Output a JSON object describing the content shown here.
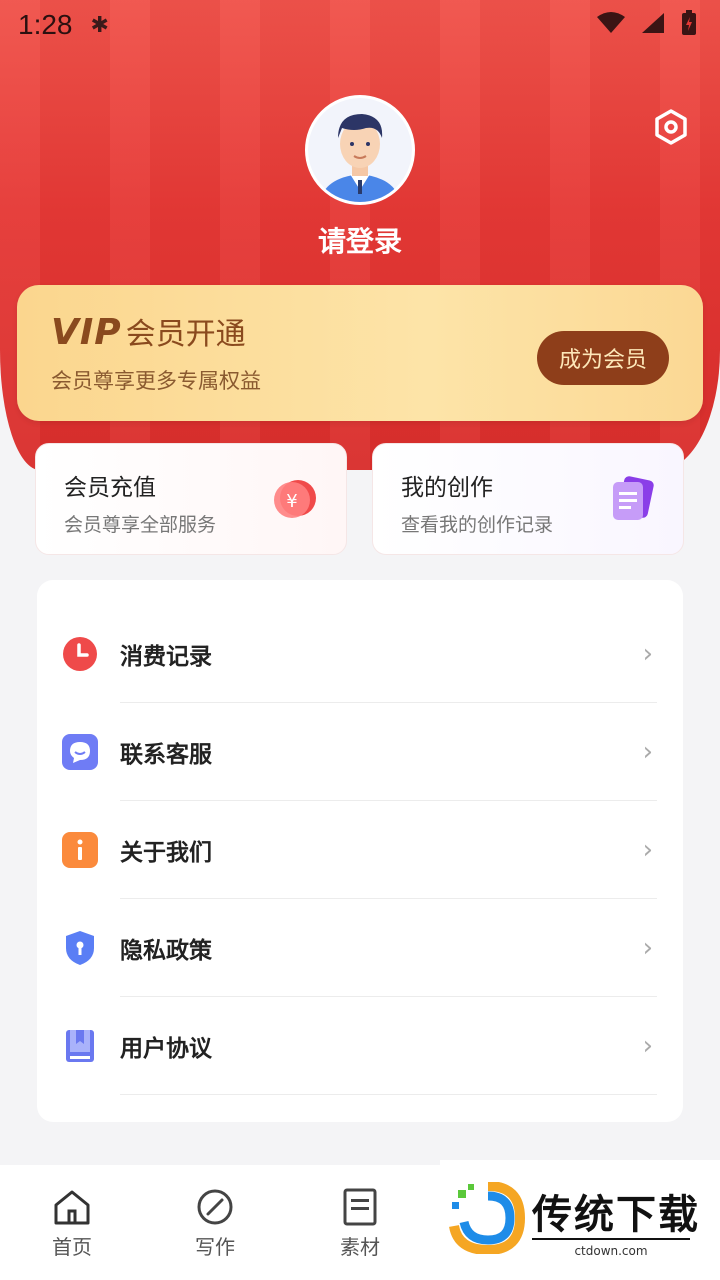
{
  "status_bar": {
    "time": "1:28"
  },
  "profile": {
    "login_text": "请登录"
  },
  "vip": {
    "logo": "VIP",
    "title": "会员开通",
    "subtitle": "会员尊享更多专属权益",
    "button": "成为会员"
  },
  "features": [
    {
      "title": "会员充值",
      "subtitle": "会员尊享全部服务",
      "icon": "yuan-coin-icon"
    },
    {
      "title": "我的创作",
      "subtitle": "查看我的创作记录",
      "icon": "document-icon"
    }
  ],
  "menu": [
    {
      "label": "消费记录",
      "icon": "clock-icon",
      "color": "#ef4a4a"
    },
    {
      "label": "联系客服",
      "icon": "chat-icon",
      "color": "#6f7cf5"
    },
    {
      "label": "关于我们",
      "icon": "info-icon",
      "color": "#fb8a3c"
    },
    {
      "label": "隐私政策",
      "icon": "shield-icon",
      "color": "#5a7ef5"
    },
    {
      "label": "用户协议",
      "icon": "book-icon",
      "color": "#6a78f0"
    }
  ],
  "bottom_nav": [
    {
      "label": "首页",
      "icon": "home-icon"
    },
    {
      "label": "写作",
      "icon": "compose-icon"
    },
    {
      "label": "素材",
      "icon": "material-icon"
    }
  ],
  "watermark": {
    "title": "传统下载",
    "url": "ctdown.com"
  },
  "colors": {
    "accent": "#e53835",
    "vip_button": "#8e3e1a"
  }
}
